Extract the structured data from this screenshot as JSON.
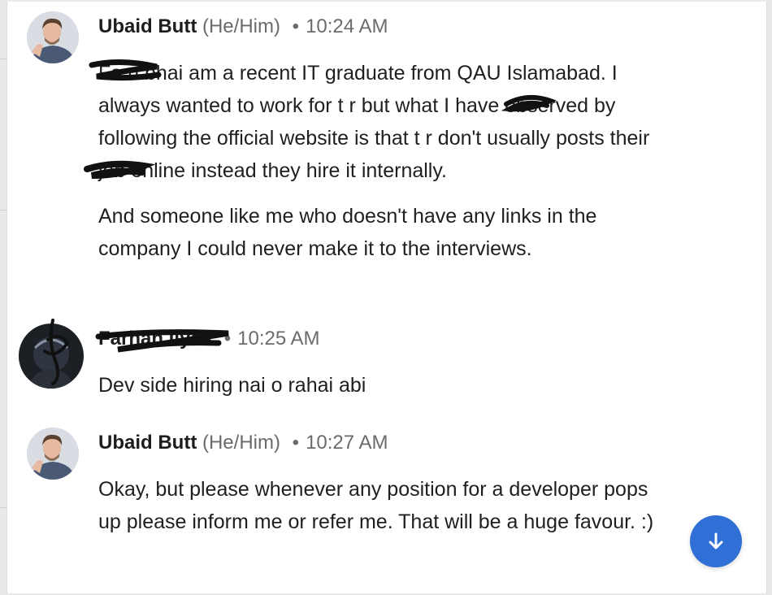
{
  "messages": [
    {
      "sender": "Ubaid Butt",
      "pronouns": "(He/Him)",
      "time": "10:24 AM",
      "paragraphs": [
        "Fa n bhai am a recent IT graduate from QAU Islamabad. I always wanted to work for t r but what I have observed by following the official website is that t r don't usually posts their job online instead they hire it internally.",
        "And someone like me who doesn't have any links in the company I could never make it to the interviews."
      ]
    },
    {
      "sender": "Farhan Ilyas",
      "time": "10:25 AM",
      "paragraphs": [
        "Dev side hiring nai o rahai abi"
      ]
    },
    {
      "sender": "Ubaid Butt",
      "pronouns": "(He/Him)",
      "time": "10:27 AM",
      "paragraphs": [
        "Okay, but please whenever any position for a developer pops up please inform me or refer me. That will be a huge favour. :)"
      ]
    }
  ],
  "scroll_button": {
    "icon": "arrow-down-icon"
  },
  "colors": {
    "accent": "#2f6fd6",
    "name": "#1d1d1d",
    "meta": "#6b6b6b"
  }
}
